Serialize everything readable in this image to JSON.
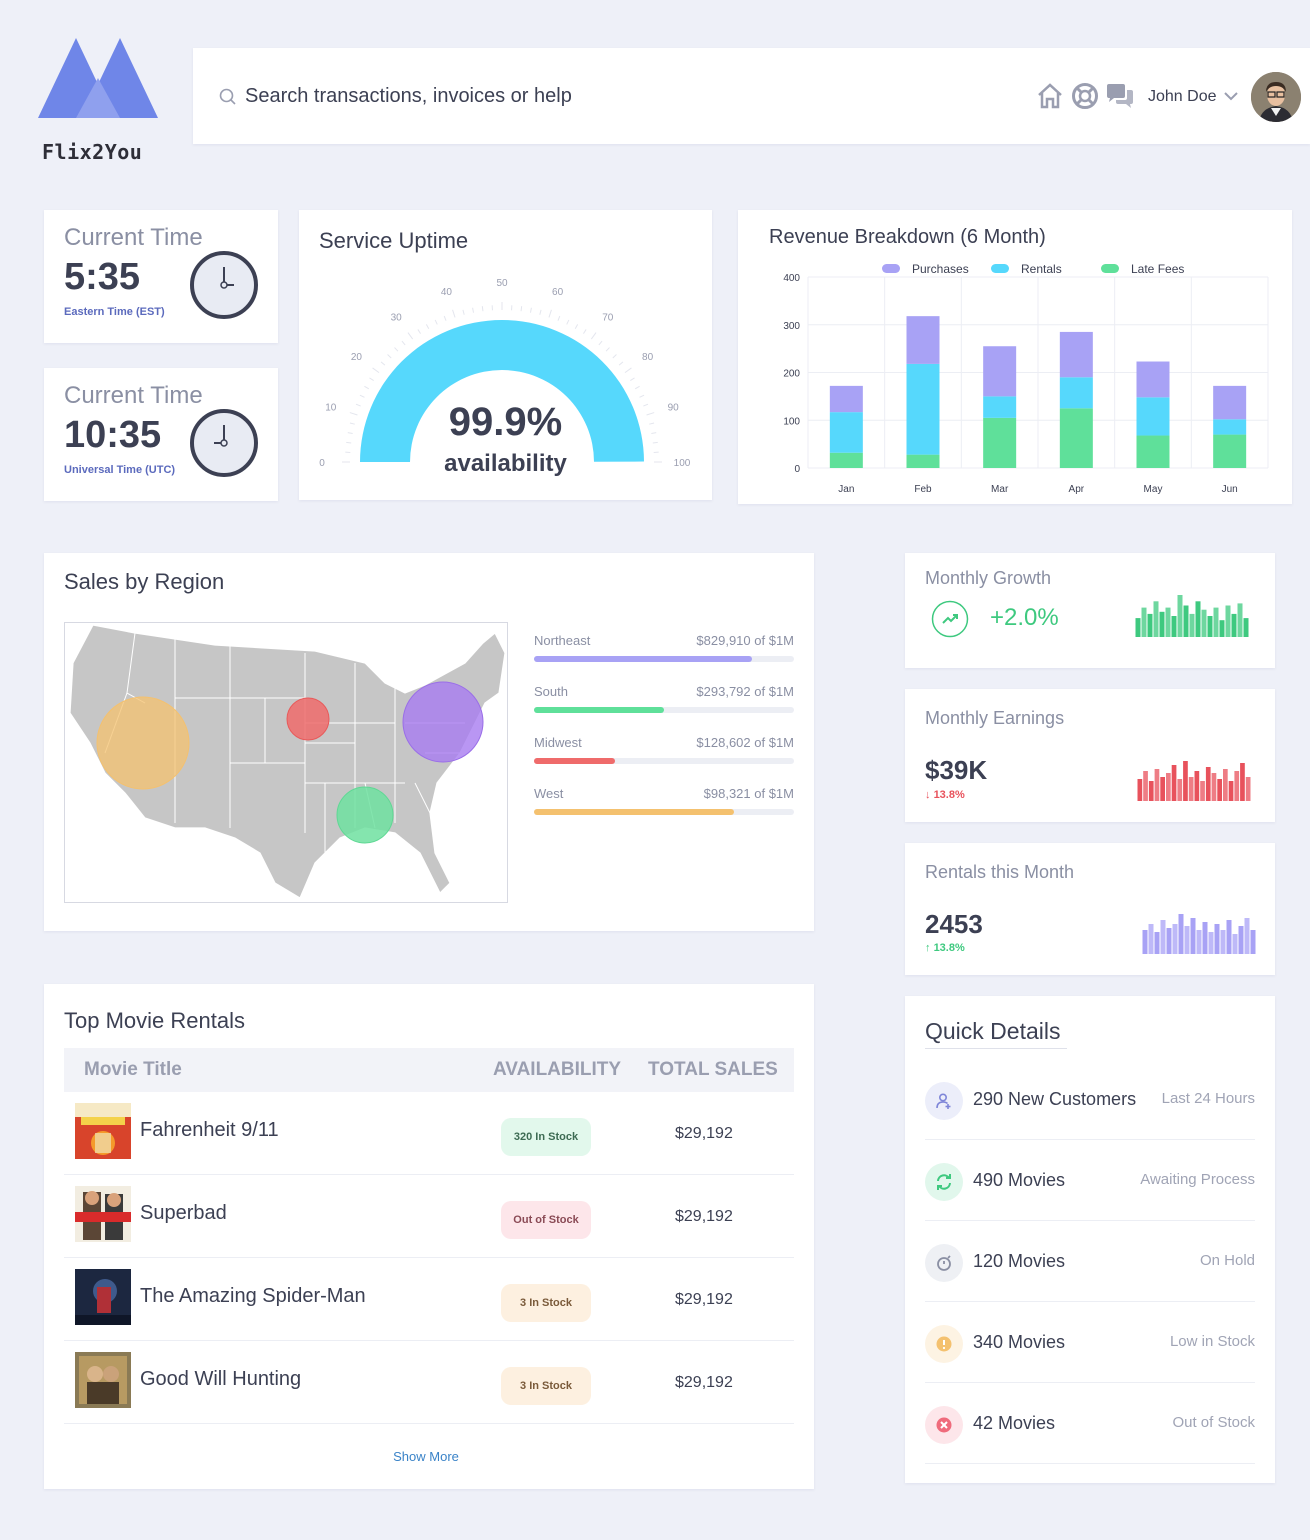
{
  "brand": {
    "name": "Flix2You",
    "colors": {
      "primary": "#6f86e8"
    }
  },
  "header": {
    "search_placeholder": "Search transactions, invoices or help",
    "icons": [
      "home-icon",
      "lifebuoy-icon",
      "chat-icon"
    ],
    "user_name": "John Doe"
  },
  "time_cards": [
    {
      "label": "Current Time",
      "time": "5:35",
      "zone": "Eastern Time (EST)"
    },
    {
      "label": "Current Time",
      "time": "10:35",
      "zone": "Universal Time (UTC)"
    }
  ],
  "uptime": {
    "title": "Service Uptime",
    "value_text": "99.9%",
    "caption": "availability",
    "value": 99.9,
    "ticks": [
      "0",
      "10",
      "20",
      "30",
      "40",
      "50",
      "60",
      "70",
      "80",
      "90",
      "100"
    ],
    "color": "#56d8fc"
  },
  "chart_data": {
    "type": "bar",
    "title": "Revenue Breakdown (6 Month)",
    "stacked": true,
    "categories": [
      "Jan",
      "Feb",
      "Mar",
      "Apr",
      "May",
      "Jun"
    ],
    "series": [
      {
        "name": "Late Fees",
        "color": "#5fe09a",
        "values": [
          32,
          28,
          105,
          125,
          68,
          70
        ]
      },
      {
        "name": "Rentals",
        "color": "#56d8fc",
        "values": [
          85,
          190,
          45,
          65,
          80,
          32
        ]
      },
      {
        "name": "Purchases",
        "color": "#a8a2f5",
        "values": [
          55,
          100,
          105,
          95,
          75,
          70
        ]
      }
    ],
    "legend_order": [
      "Purchases",
      "Rentals",
      "Late Fees"
    ],
    "legend_position": "top",
    "ylim": [
      0,
      400
    ],
    "yticks": [
      "0",
      "100",
      "200",
      "300",
      "400"
    ],
    "grid": true
  },
  "regions": {
    "title": "Sales by Region",
    "items": [
      {
        "name": "Northeast",
        "amount": "$829,910 of $1M",
        "fraction": 0.84,
        "color": "#a8a2f5"
      },
      {
        "name": "South",
        "amount": "$293,792 of $1M",
        "fraction": 0.5,
        "color": "#5fe09a"
      },
      {
        "name": "Midwest",
        "amount": "$128,602 of $1M",
        "fraction": 0.31,
        "color": "#ef6b6b"
      },
      {
        "name": "West",
        "amount": "$98,321 of $1M",
        "fraction": 0.77,
        "color": "#f4c16f"
      }
    ]
  },
  "stats": {
    "growth": {
      "label": "Monthly Growth",
      "value": "+2.0%",
      "color": "#3ec97f",
      "bars": [
        0.45,
        0.7,
        0.55,
        0.85,
        0.6,
        0.7,
        0.5,
        1.0,
        0.75,
        0.55,
        0.85,
        0.65,
        0.5,
        0.7,
        0.4,
        0.75,
        0.55,
        0.8,
        0.45
      ]
    },
    "earnings": {
      "label": "Monthly Earnings",
      "value": "$39K",
      "change": "13.8%",
      "direction": "down",
      "color": "#e8525c",
      "bars": [
        0.55,
        0.75,
        0.5,
        0.8,
        0.6,
        0.7,
        0.9,
        0.55,
        1.0,
        0.6,
        0.75,
        0.5,
        0.85,
        0.7,
        0.55,
        0.8,
        0.5,
        0.75,
        0.95,
        0.6
      ]
    },
    "rentals": {
      "label": "Rentals this Month",
      "value": "2453",
      "change": "13.8%",
      "direction": "up",
      "color": "#a8a2f5",
      "bars": [
        0.6,
        0.75,
        0.55,
        0.85,
        0.65,
        0.75,
        1.0,
        0.7,
        0.9,
        0.6,
        0.8,
        0.55,
        0.75,
        0.6,
        0.85,
        0.5,
        0.7,
        0.9,
        0.6
      ]
    }
  },
  "movies": {
    "title": "Top Movie Rentals",
    "columns": {
      "title": "Movie Title",
      "availability": "AVAILABILITY",
      "sales": "TOTAL SALES"
    },
    "rows": [
      {
        "title": "Fahrenheit 9/11",
        "stock": "320 In Stock",
        "sales": "$29,192",
        "status": "ok"
      },
      {
        "title": "Superbad",
        "stock": "Out of Stock",
        "sales": "$29,192",
        "status": "out"
      },
      {
        "title": "The Amazing Spider-Man",
        "stock": "3 In Stock",
        "sales": "$29,192",
        "status": "low"
      },
      {
        "title": "Good Will Hunting",
        "stock": "3 In Stock",
        "sales": "$29,192",
        "status": "low"
      }
    ],
    "show_more": "Show More"
  },
  "quick_details": {
    "title": "Quick Details",
    "items": [
      {
        "main": "290 New Customers",
        "note": "Last 24 Hours",
        "icon": "add-user-icon",
        "color": "#7f86d8",
        "bg": "#eceefa"
      },
      {
        "main": "490 Movies",
        "note": "Awaiting Process",
        "icon": "refresh-icon",
        "color": "#3ec97f",
        "bg": "#e1f7ec"
      },
      {
        "main": "120 Movies",
        "note": "On Hold",
        "icon": "timer-icon",
        "color": "#8a8fa3",
        "bg": "#eef0f4"
      },
      {
        "main": "340 Movies",
        "note": "Low in Stock",
        "icon": "alert-icon",
        "color": "#f4c16f",
        "bg": "#fdf3e3"
      },
      {
        "main": "42 Movies",
        "note": "Out of Stock",
        "icon": "cancel-icon",
        "color": "#ef6b7c",
        "bg": "#fde6ea"
      }
    ]
  }
}
